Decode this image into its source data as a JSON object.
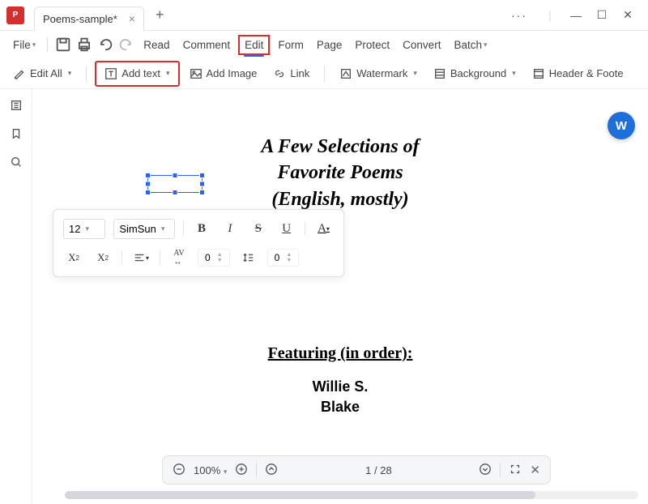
{
  "titlebar": {
    "tab_title": "Poems-sample*"
  },
  "menubar": {
    "file": "File",
    "read": "Read",
    "comment": "Comment",
    "edit": "Edit",
    "form": "Form",
    "page": "Page",
    "protect": "Protect",
    "convert": "Convert",
    "batch": "Batch"
  },
  "toolbar": {
    "edit_all": "Edit All",
    "add_text": "Add text",
    "add_image": "Add Image",
    "link": "Link",
    "watermark": "Watermark",
    "background": "Background",
    "header_footer": "Header & Foote"
  },
  "format_panel": {
    "font_size": "12",
    "font_name": "SimSun",
    "letter_spacing": "0",
    "line_height": "0"
  },
  "document": {
    "title_lines": "A Few Selections of Favorite Poems (English, mostly)",
    "featuring_label": "Featuring (in order):",
    "author1": "Willie S.",
    "author2": "Blake"
  },
  "statusbar": {
    "zoom": "100%",
    "page_current": "1",
    "page_sep": "/",
    "page_total": "28"
  },
  "float": {
    "word_label": "W"
  }
}
